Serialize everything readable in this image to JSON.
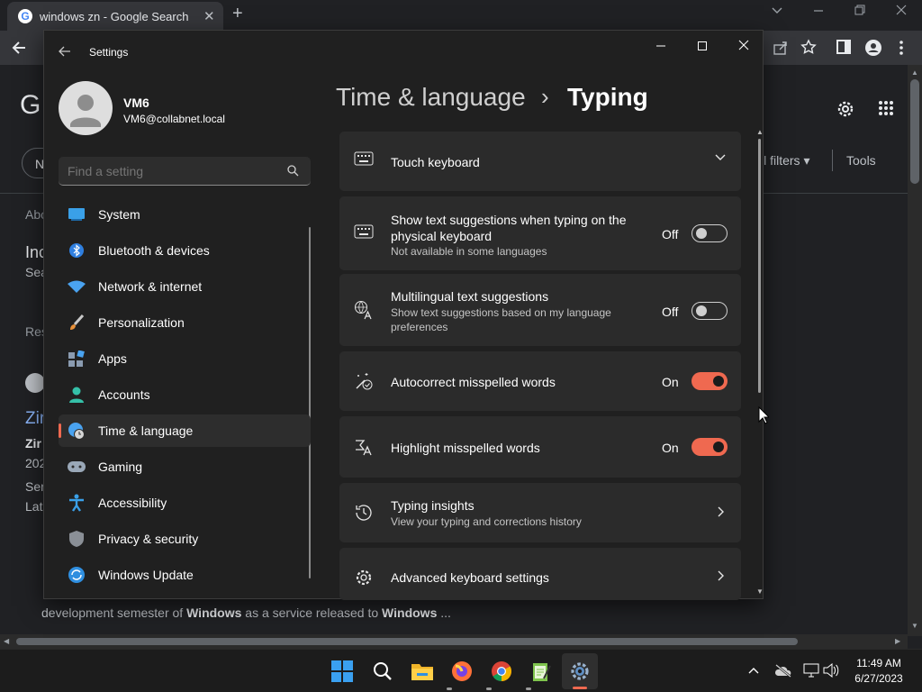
{
  "browser": {
    "tab_title": "windows zn - Google Search",
    "new_tab": "+",
    "tab_close": "✕"
  },
  "background_page": {
    "logo_fragment": "G",
    "filters": "ll filters",
    "tools": "Tools",
    "about": "Abo",
    "inc": "Inc",
    "sea": "Sea",
    "res": "Res",
    "zir": "Zir",
    "zir_bold": "Zir",
    "n202": "202",
    "ser": "Ser",
    "lat": "Lat",
    "n_fragment": "N",
    "snippet_part1": "development semester of ",
    "snippet_bold1": "Windows",
    "snippet_part2": " as a service released to ",
    "snippet_bold2": "Windows",
    "snippet_part3": " ..."
  },
  "settings": {
    "window_title": "Settings",
    "user": {
      "name": "VM6",
      "email": "VM6@collabnet.local"
    },
    "search_placeholder": "Find a setting",
    "breadcrumb": {
      "parent": "Time & language",
      "separator": "›",
      "current": "Typing"
    },
    "nav_items": [
      {
        "label": "System",
        "icon": "system-icon"
      },
      {
        "label": "Bluetooth & devices",
        "icon": "bluetooth-icon"
      },
      {
        "label": "Network & internet",
        "icon": "wifi-icon"
      },
      {
        "label": "Personalization",
        "icon": "brush-icon"
      },
      {
        "label": "Apps",
        "icon": "apps-icon"
      },
      {
        "label": "Accounts",
        "icon": "accounts-icon"
      },
      {
        "label": "Time & language",
        "icon": "globe-clock-icon",
        "selected": true
      },
      {
        "label": "Gaming",
        "icon": "gamepad-icon"
      },
      {
        "label": "Accessibility",
        "icon": "accessibility-icon"
      },
      {
        "label": "Privacy & security",
        "icon": "shield-icon"
      },
      {
        "label": "Windows Update",
        "icon": "update-icon"
      }
    ],
    "cards": {
      "touch_keyboard": {
        "title": "Touch keyboard"
      },
      "text_suggestions": {
        "title_line1": "Show text suggestions when typing on the",
        "title_line2": "physical keyboard",
        "subtitle": "Not available in some languages",
        "state": "Off"
      },
      "multilingual": {
        "title": "Multilingual text suggestions",
        "subtitle_line1": "Show text suggestions based on my language",
        "subtitle_line2": "preferences",
        "state": "Off"
      },
      "autocorrect": {
        "title": "Autocorrect misspelled words",
        "state": "On"
      },
      "highlight": {
        "title": "Highlight misspelled words",
        "state": "On"
      },
      "insights": {
        "title": "Typing insights",
        "subtitle": "View your typing and corrections history"
      },
      "advanced": {
        "title": "Advanced keyboard settings"
      }
    }
  },
  "taskbar": {
    "time": "11:49 AM",
    "date": "6/27/2023"
  },
  "colors": {
    "accent": "#ef6950",
    "window_bg": "#202020",
    "card_bg": "#2b2b2b"
  }
}
